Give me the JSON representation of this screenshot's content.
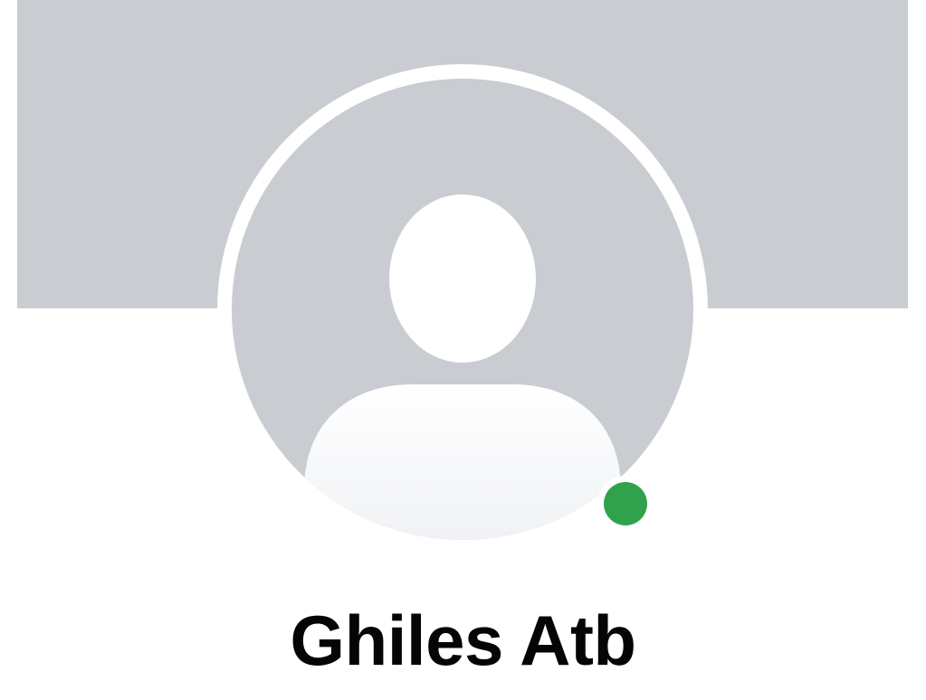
{
  "profile": {
    "name": "Ghiles Atb",
    "avatar_icon": "default-user-silhouette-icon",
    "presence_status": "online"
  },
  "colors": {
    "cover": "#c9ccd1",
    "avatar_background": "#c9ccd1",
    "silhouette": "#ffffff",
    "presence_online": "#31a24c",
    "name_text": "#050505"
  }
}
